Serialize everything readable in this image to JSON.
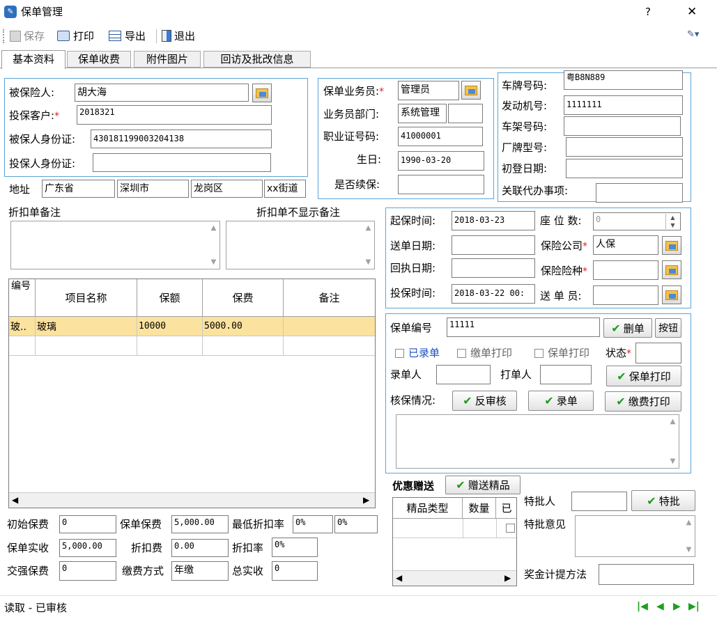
{
  "window": {
    "title": "保单管理",
    "help": "?",
    "close": "✕"
  },
  "toolbar": {
    "save": "保存",
    "print": "打印",
    "export": "导出",
    "exit": "退出"
  },
  "tabs": [
    "基本资料",
    "保单收费",
    "附件图片",
    "回访及批改信息"
  ],
  "insured": {
    "insured_label": "被保险人:",
    "insured_value": "胡大海",
    "client_label": "投保客户:",
    "client_value": "2018321",
    "insured_id_label": "被保人身份证:",
    "insured_id_value": "430181199003204138",
    "applicant_id_label": "投保人身份证:",
    "applicant_id_value": ""
  },
  "address": {
    "label": "地址",
    "province": "广东省",
    "city": "深圳市",
    "district": "龙岗区",
    "street": "xx街道"
  },
  "agent": {
    "agent_label": "保单业务员:",
    "agent_value": "管理员",
    "dept_label": "业务员部门:",
    "dept_value": "系统管理",
    "dept_extra": "",
    "cert_label": "职业证号码:",
    "cert_value": "41000001",
    "birthday_label": "生日:",
    "birthday_value": "1990-03-20",
    "renew_label": "是否续保:",
    "renew_value": ""
  },
  "vehicle": {
    "plate_label": "车牌号码:",
    "plate_value": "粤B8N889",
    "engine_label": "发动机号:",
    "engine_value": "1111111",
    "frame_label": "车架号码:",
    "frame_value": "",
    "model_label": "厂牌型号:",
    "model_value": "",
    "register_label": "初登日期:",
    "register_value": "",
    "related_label": "关联代办事项:",
    "related_value": ""
  },
  "notes": {
    "discount_note_label": "折扣单备注",
    "hidden_note_label": "折扣单不显示备注"
  },
  "items_table": {
    "headers": [
      "编号",
      "项目名称",
      "保额",
      "保费",
      "备注"
    ],
    "rows": [
      {
        "no": "玻..",
        "name": "玻璃",
        "amount": "10000",
        "premium": "5000.00",
        "note": ""
      }
    ]
  },
  "premiums": {
    "initial_label": "初始保费",
    "initial_value": "0",
    "policy_premium_label": "保单保费",
    "policy_premium_value": "5,000.00",
    "min_rate_label": "最低折扣率",
    "min_rate_value": "0%",
    "min_rate_value2": "0%",
    "actual_label": "保单实收",
    "actual_value": "5,000.00",
    "discount_fee_label": "折扣费",
    "discount_fee_value": "0.00",
    "discount_rate_label": "折扣率",
    "discount_rate_value": "0%",
    "compulsory_label": "交强保费",
    "compulsory_value": "0",
    "pay_method_label": "缴费方式",
    "pay_method_value": "年缴",
    "total_label": "总实收",
    "total_value": "0"
  },
  "dates": {
    "start_label": "起保时间:",
    "start_value": "2018-03-23",
    "seats_label": "座 位 数:",
    "seats_value": "0",
    "send_date_label": "送单日期:",
    "send_date_value": "",
    "company_label": "保险公司",
    "company_value": "人保",
    "return_date_label": "回执日期:",
    "return_date_value": "",
    "type_label": "保险险种",
    "type_value": "",
    "insure_time_label": "投保时间:",
    "insure_time_value": "2018-03-22 00:",
    "sender_label": "送 单 员:",
    "sender_value": ""
  },
  "policy": {
    "no_label": "保单编号",
    "no_value": "11111",
    "delete_btn": "删单",
    "delete_btn2": "按钮",
    "recorded": "已录单",
    "pay_print": "缴单打印",
    "policy_print_chk": "保单打印",
    "status_label": "状态",
    "status_value": "",
    "recorder_label": "录单人",
    "recorder_value": "",
    "printer_label": "打单人",
    "printer_value": "",
    "print_btn": "保单打印",
    "check_label": "核保情况:",
    "reverse_btn": "反审核",
    "record_btn": "录单",
    "fee_print_btn": "缴费打印"
  },
  "gifts": {
    "label": "优惠赠送",
    "gift_btn": "赠送精品",
    "headers": [
      "精品类型",
      "数量",
      "已"
    ]
  },
  "approval": {
    "approver_label": "特批人",
    "approver_value": "",
    "approve_btn": "特批",
    "opinion_label": "特批意见",
    "bonus_label": "奖金计提方法",
    "bonus_value": ""
  },
  "status": {
    "text": "读取 - 已审核"
  },
  "colors": {
    "group_border": "#5aa5d8",
    "row_highlight": "#fbe29e",
    "required": "#e02020",
    "nav": "#1ca01c"
  }
}
